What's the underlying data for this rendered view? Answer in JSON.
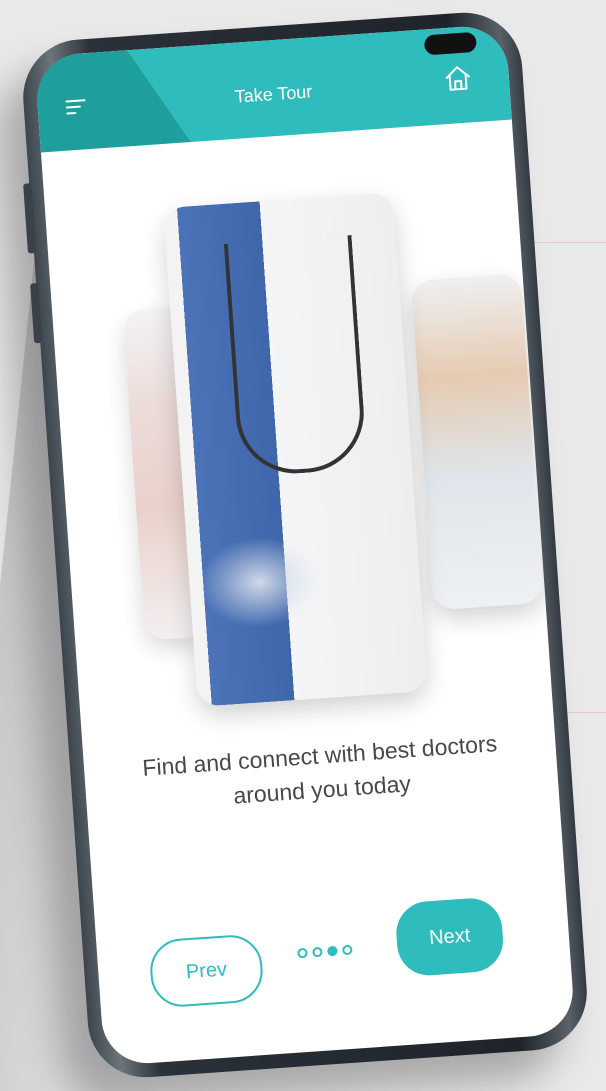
{
  "header": {
    "title": "Take Tour",
    "menu_icon": "menu-icon",
    "home_icon": "home-icon"
  },
  "carousel": {
    "caption": "Find and connect with best doctors around you today",
    "total_slides": 4,
    "current_slide": 3
  },
  "buttons": {
    "prev_label": "Prev",
    "next_label": "Next"
  },
  "colors": {
    "accent": "#2fbcbc",
    "accent_dark": "#1f9e9e",
    "text": "#45484c",
    "background": "#e9e9ea"
  }
}
